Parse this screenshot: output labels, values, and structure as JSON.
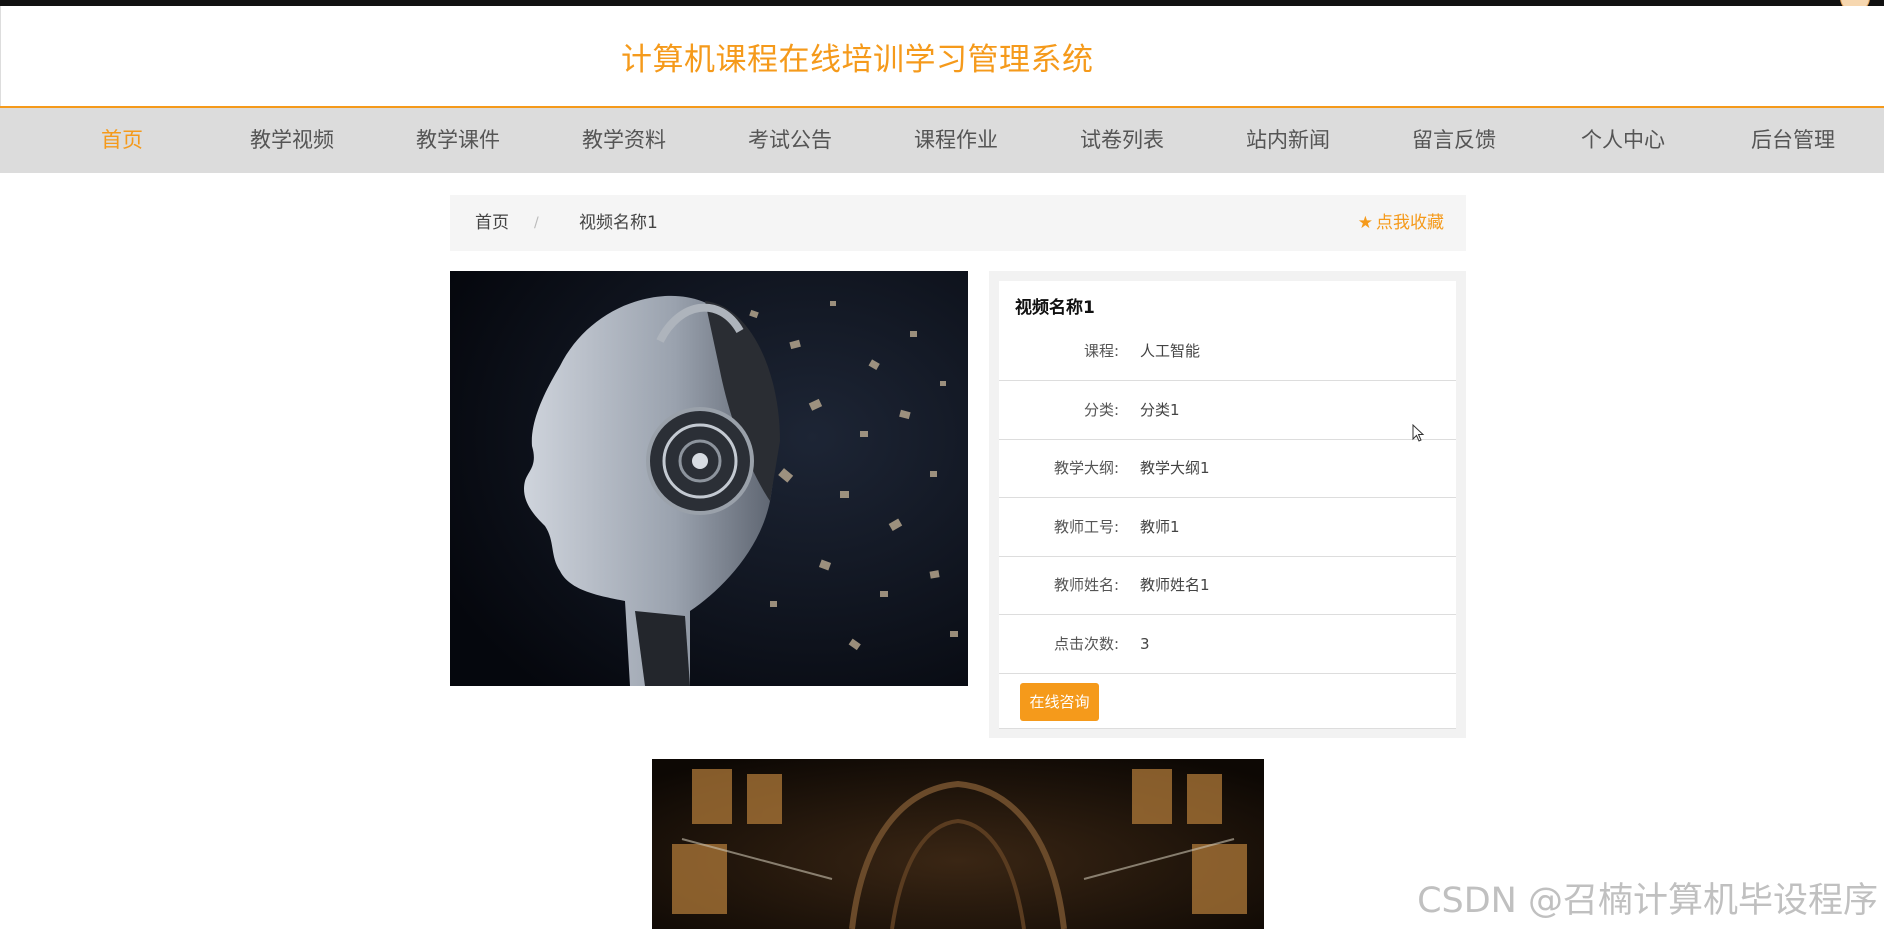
{
  "site": {
    "title": "计算机课程在线培训学习管理系统"
  },
  "nav": {
    "items": [
      {
        "label": "首页",
        "active": true
      },
      {
        "label": "教学视频"
      },
      {
        "label": "教学课件"
      },
      {
        "label": "教学资料"
      },
      {
        "label": "考试公告"
      },
      {
        "label": "课程作业"
      },
      {
        "label": "试卷列表"
      },
      {
        "label": "站内新闻"
      },
      {
        "label": "留言反馈"
      },
      {
        "label": "个人中心"
      },
      {
        "label": "后台管理"
      }
    ]
  },
  "breadcrumb": {
    "home": "首页",
    "separator": "/",
    "current": "视频名称1",
    "favorite": "点我收藏"
  },
  "detail": {
    "title": "视频名称1",
    "rows": [
      {
        "label": "课程:",
        "value": "人工智能"
      },
      {
        "label": "分类:",
        "value": "分类1"
      },
      {
        "label": "教学大纲:",
        "value": "教学大纲1"
      },
      {
        "label": "教师工号:",
        "value": "教师1"
      },
      {
        "label": "教师姓名:",
        "value": "教师姓名1"
      },
      {
        "label": "点击次数:",
        "value": "3"
      }
    ],
    "consult_button": "在线咨询"
  },
  "watermark": "CSDN @召楠计算机毕设程序",
  "colors": {
    "accent": "#f59a1b",
    "nav_bg": "#dcdcdc"
  },
  "icons": {
    "favorite": "star-icon",
    "pointer": "mouse-cursor-icon"
  }
}
